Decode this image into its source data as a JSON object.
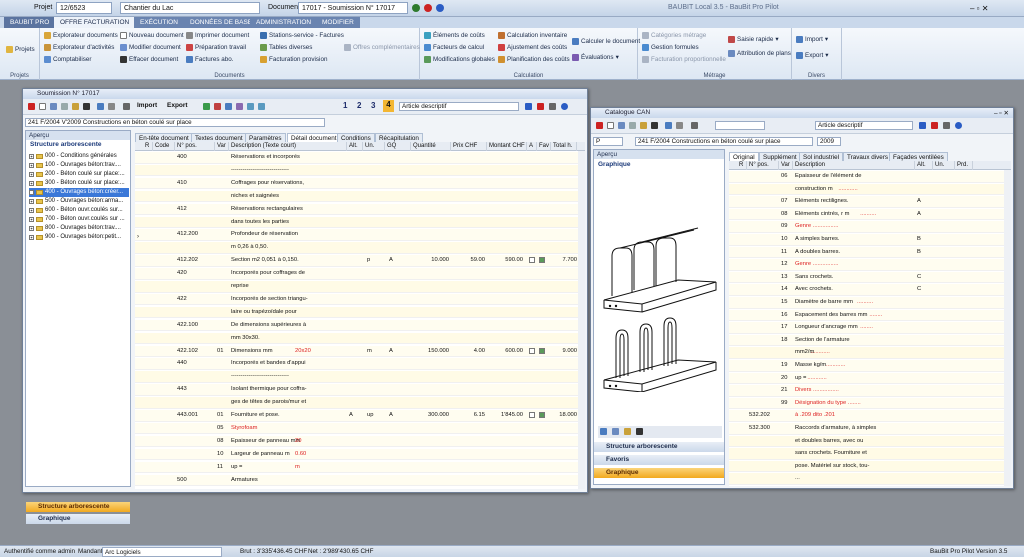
{
  "top": {
    "projet_label": "Projet",
    "projet": "12/6523",
    "chantier": "Chantier du Lac",
    "document_label": "Document",
    "document": "17017 - Soumission N° 17017",
    "app_title": "BAUBIT Local 3.5 - BauBit Pro Pilot"
  },
  "tabs": [
    "BAUBIT PRO",
    "OFFRE FACTURATION",
    "EXÉCUTION",
    "DONNÉES DE BASE",
    "ADMINISTRATION",
    "MODIFIER"
  ],
  "ribbon": {
    "projets": {
      "caption": "Projets",
      "items": [
        "Projets"
      ]
    },
    "documents": {
      "caption": "Documents",
      "items": [
        "Explorateur documents",
        "Explorateur d'activités",
        "Comptabiliser",
        "Nouveau document",
        "Modifier document",
        "Effacer document",
        "Imprimer document",
        "Préparation travail",
        "Factures abo.",
        "Stations-service - Factures",
        "Tables diverses",
        "Facturation provision",
        "Offres complémentaires"
      ]
    },
    "calculation": {
      "caption": "Calculation",
      "items": [
        "Éléments de coûts",
        "Facteurs de calcul",
        "Modifications globales",
        "Calculation inventaire",
        "Ajustement des coûts",
        "Planification des coûts",
        "Calculer le document",
        "Évaluations"
      ]
    },
    "metrage": {
      "caption": "Métrage",
      "items": [
        "Catégories métrage",
        "Gestion formules",
        "Facturation proportionnelle",
        "Saisie rapide",
        "Attribution de plans"
      ]
    },
    "divers": {
      "caption": "Divers",
      "items": [
        "Import",
        "Export"
      ]
    }
  },
  "left": {
    "title": "Soumission N° 17017",
    "import": "Import",
    "export": "Export",
    "pages": [
      "1",
      "2",
      "3",
      "4"
    ],
    "desc_mode": "Article descriptif",
    "doc_path": "241 F/2004 V'2009 Constructions en béton coulé sur place",
    "apercu": "Aperçu",
    "tree_title": "Structure arborescente",
    "tree": [
      "000 - Conditions générales",
      "100 - Ouvrages béton:trav....",
      "200 - Béton coulé sur place:...",
      "300 - Béton coulé sur place:...",
      "400 - Ouvrages béton:créer...",
      "500 - Ouvrages béton:arma...",
      "600 - Béton ouvr.coulés sur...",
      "700 - Béton ouvr.coulés sur ...",
      "800 - Ouvrages béton:trav....",
      "900 - Ouvrages béton:petit..."
    ],
    "nav": [
      "Structure arborescente",
      "Graphique"
    ],
    "ctabs": [
      "En-tête document",
      "Textes document",
      "Paramètres",
      "Détail document",
      "Conditions",
      "Récapitulation"
    ],
    "cols": [
      "R",
      "Code",
      "N° pos.",
      "Var",
      "Description (Texte court)",
      "Alt.",
      "Un.",
      "GQ",
      "Quantité",
      "Prix CHF",
      "Montant CHF",
      "A",
      "Fav",
      "Total h."
    ],
    "rows": [
      {
        "pos": "400",
        "desc": "Réservations et incorporés"
      },
      {
        "desc": "------------------------------"
      },
      {
        "pos": "410",
        "desc": "Coffrages pour réservations,"
      },
      {
        "desc": "niches et saignées"
      },
      {
        "pos": "412",
        "desc": "Réservations rectangulaires"
      },
      {
        "desc": "dans toutes les parties"
      },
      {
        "pos": "412.200",
        "desc": "Profondeur de réservation"
      },
      {
        "desc": "m 0,26 à 0,50."
      },
      {
        "pos": "412.202",
        "desc": "Section m2 0,051 à 0,150.",
        "un": "p",
        "gq": "A",
        "qty": "10.000",
        "prix": "59.00",
        "mont": "590.00",
        "tot": "7.700"
      },
      {
        "pos": "420",
        "desc": "Incorporés pour coffrages de"
      },
      {
        "desc": "reprise"
      },
      {
        "pos": "422",
        "desc": "Incorporés de section triangu-"
      },
      {
        "desc": "laire ou trapézoïdale pour"
      },
      {
        "pos": "422.100",
        "desc": "De dimensions supérieures à"
      },
      {
        "desc": "mm 30x30."
      },
      {
        "pos": "422.102",
        "var": "01",
        "desc": "Dimensions mm",
        "red": "20x20",
        "un": "m",
        "gq": "A",
        "qty": "150.000",
        "prix": "4.00",
        "mont": "600.00",
        "tot": "9.000"
      },
      {
        "pos": "440",
        "desc": "Incorporés et bandes d'appui"
      },
      {
        "desc": "------------------------------"
      },
      {
        "pos": "443",
        "desc": "Isolant thermique pour coffra-"
      },
      {
        "desc": "ges de têtes de parois/mur et"
      },
      {
        "pos": "443.001",
        "var": "01",
        "desc": "Fourniture et pose.",
        "alt": "A",
        "un": "up",
        "gq": "A",
        "qty": "300.000",
        "prix": "6.15",
        "mont": "1'845.00",
        "tot": "18.000"
      },
      {
        "var": "05",
        "desc": "",
        "red": "Styrofoam"
      },
      {
        "var": "08",
        "desc": "Epaisseur de panneau mm",
        "red": "20"
      },
      {
        "var": "10",
        "desc": "Largeur de panneau m",
        "red": "0.60"
      },
      {
        "var": "11",
        "desc": "up =",
        "red": "m"
      },
      {
        "pos": "500",
        "desc": "Armatures"
      }
    ]
  },
  "right": {
    "title": "Catalogue CAN",
    "p_label": "P",
    "desc_mode": "Article descriptif",
    "doc_path": "241 F/2004 Constructions en béton coulé sur place",
    "year": "2009",
    "apercu": "Aperçu",
    "graphique": "Graphique",
    "nav": [
      "Structure arborescente",
      "Favoris",
      "Graphique"
    ],
    "ctabs": [
      "Original",
      "Supplément",
      "Sol industriel",
      "Travaux divers",
      "Façades ventilées"
    ],
    "cols": [
      "R",
      "N° pos.",
      "Var",
      "Description",
      "Alt.",
      "Un.",
      "Prd."
    ],
    "rows": [
      {
        "var": "06",
        "desc": "Epaisseur de l'élément de"
      },
      {
        "desc": "construction m",
        "red": " ............"
      },
      {
        "var": "07",
        "desc": "Eléments rectilignes.",
        "alt": "A"
      },
      {
        "var": "08",
        "desc": "Eléments cintrés, r m",
        "red": " ..........",
        "alt": "A"
      },
      {
        "var": "09",
        "desc": "",
        "red": "Genre ................"
      },
      {
        "var": "10",
        "desc": "A simples barres.",
        "alt": "B"
      },
      {
        "var": "11",
        "desc": "A doubles barres.",
        "alt": "B"
      },
      {
        "var": "12",
        "desc": "",
        "red": "Genre ................"
      },
      {
        "var": "13",
        "desc": "Sans crochets.",
        "alt": "C"
      },
      {
        "var": "14",
        "desc": "Avec crochets.",
        "alt": "C"
      },
      {
        "var": "15",
        "desc": "Diamètre de barre mm",
        "red": " .........."
      },
      {
        "var": "16",
        "desc": "Espacement des barres mm",
        "red": " ........"
      },
      {
        "var": "17",
        "desc": "Longueur d'ancrage mm",
        "red": " ........"
      },
      {
        "var": "18",
        "desc": "Section de l'armature"
      },
      {
        "desc": "mm2/m",
        "red": " ............"
      },
      {
        "var": "19",
        "desc": "Masse kg/m",
        "red": " ............"
      },
      {
        "var": "20",
        "desc": "up =",
        "red": " ............"
      },
      {
        "var": "21",
        "desc": "",
        "red": "Divers ................"
      },
      {
        "var": "99",
        "desc": "",
        "red": "Désignation du type ........"
      },
      {
        "pos": "532.202",
        "desc": "",
        "red": "à .209 dito .201"
      },
      {
        "pos": "532.300",
        "desc": "Raccords d'armature, à simples"
      },
      {
        "desc": "et doubles barres, avec ou"
      },
      {
        "desc": "sans crochets. Fourniture et"
      },
      {
        "desc": "pose. Matériel sur stock, tou-"
      },
      {
        "desc": "..."
      }
    ]
  },
  "status": {
    "user": "Authentifié comme  admin",
    "mandant_label": "Mandant",
    "mandant": "Arc Logiciels",
    "brut": "Brut : 3'335'436.45 CHF",
    "net": "Net : 2'989'430.65 CHF",
    "version": "BauBit Pro Pilot Version 3.5"
  }
}
